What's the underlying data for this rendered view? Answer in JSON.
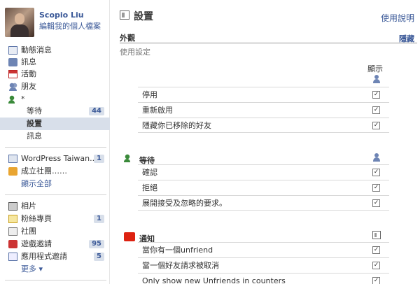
{
  "profile": {
    "name": "Scopio Liu",
    "edit_label": "編輯我的個人檔案"
  },
  "nav": {
    "news": "動態消息",
    "messages": "訊息",
    "events": "活動",
    "friends": "朋友",
    "friends_sub_star": "*",
    "wait": {
      "label": "等待",
      "count": "44"
    },
    "settings": "設置",
    "messages_sub": "訊息",
    "wordpress": {
      "label": "WordPress Taiwan...",
      "count": "1"
    },
    "create_group": "成立社團……",
    "show_all": "顯示全部",
    "photos": "相片",
    "fan_pages": {
      "label": "粉絲專頁",
      "count": "1"
    },
    "groups": "社團",
    "game_invites": {
      "label": "遊戲邀請",
      "count": "95"
    },
    "app_invites": {
      "label": "應用程式邀請",
      "count": "5"
    },
    "more": "更多 ▾"
  },
  "main": {
    "title": "設置",
    "help": "使用說明",
    "appearance": {
      "heading": "外觀",
      "hide": "隱藏",
      "subtitle": "使用設定"
    },
    "column_label": "顯示",
    "appearance_rows": [
      "停用",
      "重新啟用",
      "隱藏你已移除的好友"
    ],
    "wait_group": {
      "label": "等待",
      "rows": [
        "確認",
        "拒絕",
        "展開接受及忽略的要求。"
      ]
    },
    "notify_group": {
      "label": "通知",
      "rows": [
        "當你有一個unfriend",
        "當一個好友請求被取消",
        "Only show new Unfriends in counters"
      ]
    }
  },
  "colors": {
    "link": "#3b5998",
    "selected_bg": "#d8dfea",
    "notify_icon": "#d21"
  }
}
